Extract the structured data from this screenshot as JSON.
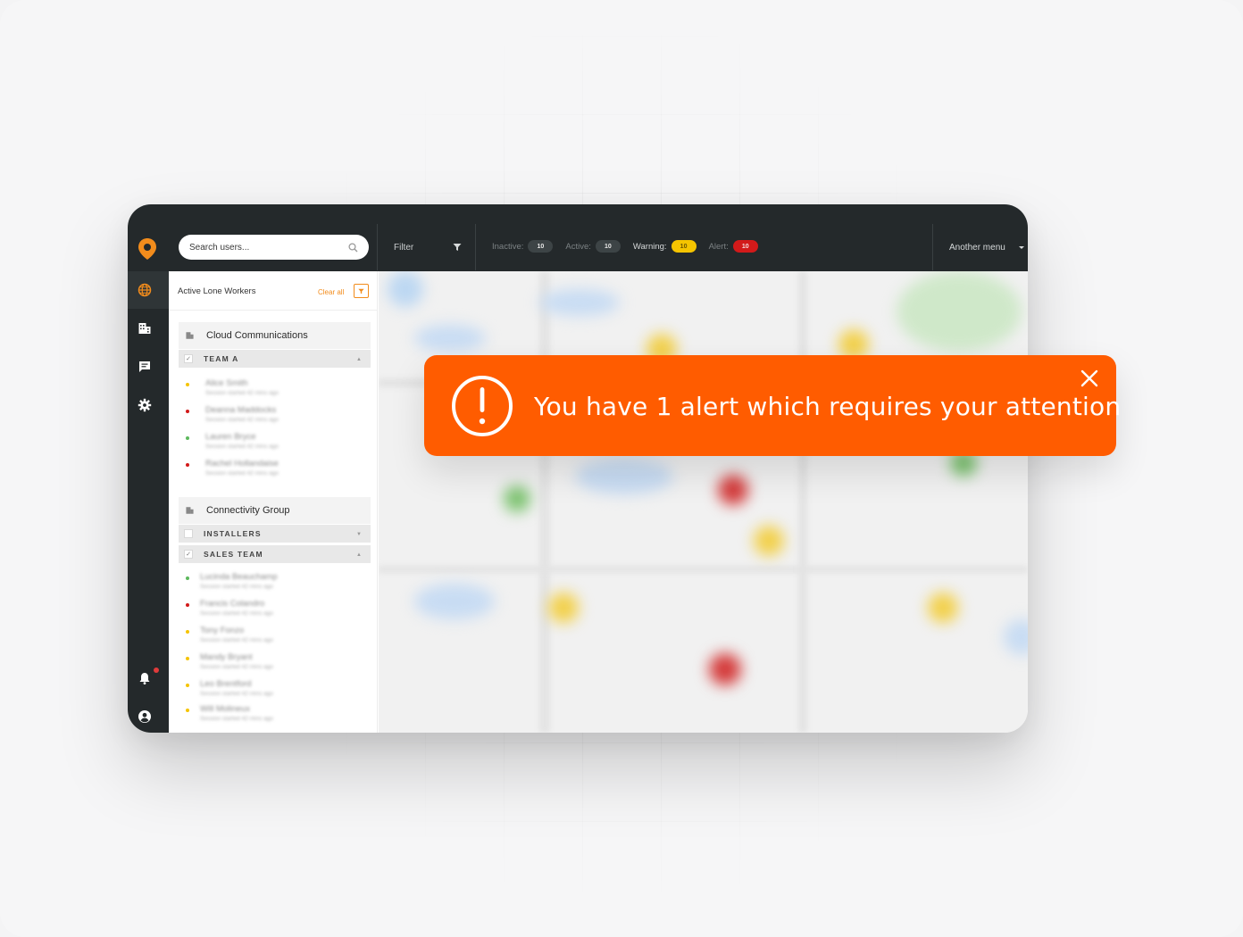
{
  "topbar": {
    "search_placeholder": "Search users...",
    "filter_label": "Filter",
    "statuses": [
      {
        "label": "Inactive:",
        "count": "10",
        "color": "#3d4446"
      },
      {
        "label": "Active:",
        "count": "10",
        "color": "#3d4446"
      },
      {
        "label": "Warning:",
        "count": "10",
        "color": "#f5c400"
      },
      {
        "label": "Alert:",
        "count": "10",
        "color": "#d21a1a"
      }
    ],
    "another_menu": "Another menu"
  },
  "rail": {
    "icons": [
      "location-pin-icon",
      "globe-icon",
      "building-icon",
      "chat-icon",
      "gear-icon",
      "bell-icon",
      "user-icon"
    ],
    "accent": "#f28c1c"
  },
  "panel": {
    "title": "Active Lone Workers",
    "clear_all": "Clear all",
    "orgs": [
      {
        "name": "Cloud Communications",
        "teams": [
          {
            "name": "TEAM A",
            "checked": true,
            "expanded": true,
            "workers": [
              {
                "name": "Alice Smith",
                "sub": "Session started 42 mins ago",
                "status": "#f5c400"
              },
              {
                "name": "Deanna Maddocks",
                "sub": "Session started 42 mins ago",
                "status": "#d21a1a"
              },
              {
                "name": "Lauren Bryce",
                "sub": "Session started 42 mins ago",
                "status": "#5cb85c"
              },
              {
                "name": "Rachel Hollandaise",
                "sub": "Session started 42 mins ago",
                "status": "#d21a1a"
              }
            ]
          }
        ]
      },
      {
        "name": "Connectivity Group",
        "teams": [
          {
            "name": "INSTALLERS",
            "checked": false,
            "expanded": false,
            "workers": []
          },
          {
            "name": "SALES TEAM",
            "checked": true,
            "expanded": true,
            "workers": [
              {
                "name": "Lucinda Beauchamp",
                "sub": "Session started 42 mins ago",
                "status": "#5cb85c"
              },
              {
                "name": "Francis Colandro",
                "sub": "Session started 42 mins ago",
                "status": "#d21a1a"
              },
              {
                "name": "Tony Fonzo",
                "sub": "Session started 42 mins ago",
                "status": "#f5c400"
              },
              {
                "name": "Mandy Bryant",
                "sub": "Session started 42 mins ago",
                "status": "#f5c400"
              },
              {
                "name": "Leo Brentford",
                "sub": "Session started 42 mins ago",
                "status": "#f5c400"
              },
              {
                "name": "Will Molineux",
                "sub": "Session started 42 mins ago",
                "status": "#f5c400"
              }
            ]
          }
        ]
      }
    ]
  },
  "toast": {
    "message": "You have 1 alert which requires your attention",
    "color": "#ff5c00"
  }
}
